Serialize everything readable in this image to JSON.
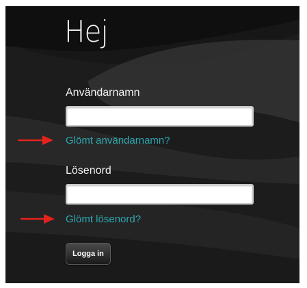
{
  "login": {
    "title": "Hej",
    "username_label": "Användarnamn",
    "username_value": "",
    "forgot_username": "Glömt användarnamn?",
    "password_label": "Lösenord",
    "password_value": "",
    "forgot_password": "Glömt lösenord?",
    "submit_label": "Logga in"
  },
  "colors": {
    "background": "#1e1e1e",
    "link": "#2fa6b0",
    "annotation_arrow": "#e3231c"
  },
  "icons": {
    "annotation": "red-arrow-right-icon"
  }
}
